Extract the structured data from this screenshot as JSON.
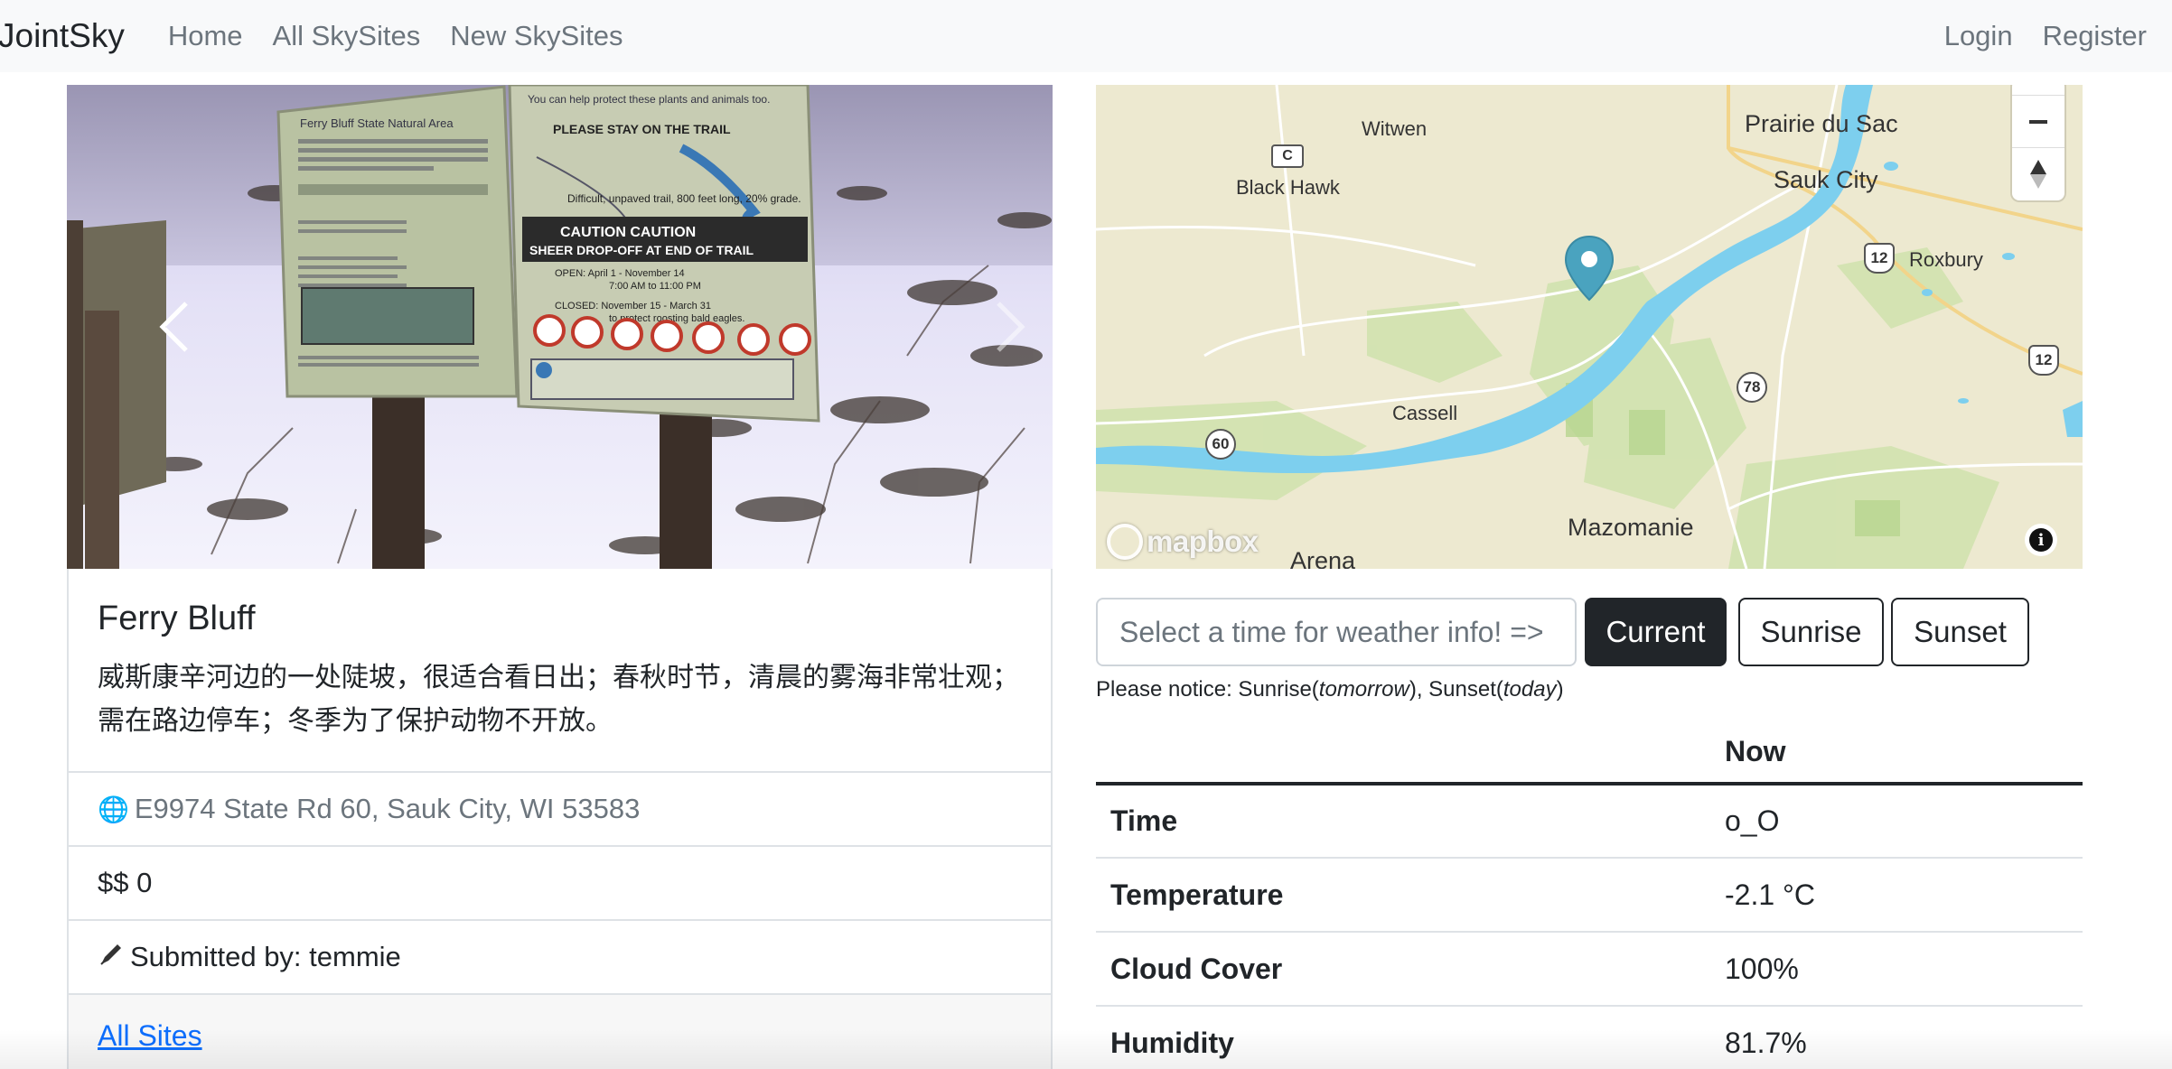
{
  "navbar": {
    "brand": "JointSky",
    "links": [
      "Home",
      "All SkySites",
      "New SkySites"
    ],
    "right_links": [
      "Login",
      "Register"
    ]
  },
  "carousel": {
    "sign_title": "Ferry Bluff State Natural Area",
    "sign_header": "You can help protect these plants and animals too.",
    "sign_stay": "PLEASE STAY ON THE TRAIL",
    "sign_trail": "Difficult, unpaved trail, 800 feet long, 20% grade.",
    "sign_caution": "CAUTION     CAUTION",
    "sign_dropoff": "SHEER DROP-OFF AT END OF TRAIL",
    "sign_open": "OPEN:     April 1 - November 14",
    "sign_open_hours": "7:00 AM to 11:00 PM",
    "sign_closed": "CLOSED:  November 15 - March 31",
    "sign_closed_reason": "to protect roosting bald eagles.",
    "prev_icon": "chevron-left-icon",
    "next_icon": "chevron-right-icon"
  },
  "site": {
    "title": "Ferry Bluff",
    "description": "威斯康辛河边的一处陡坡，很适合看日出；春秋时节，清晨的雾海非常壮观；需在路边停车；冬季为了保护动物不开放。",
    "address_icon": "globe-icon",
    "address": "E9974 State Rd 60, Sauk City, WI 53583",
    "price": "$$ 0",
    "submitted_icon": "pen-icon",
    "submitted_by": "Submitted by: temmie",
    "all_sites_link": "All Sites"
  },
  "map": {
    "labels": {
      "witwen": "Witwen",
      "black_hawk": "Black Hawk",
      "prairie_du_sac": "Prairie du Sac",
      "sauk_city": "Sauk City",
      "roxbury": "Roxbury",
      "cassell": "Cassell",
      "mazomanie": "Mazomanie",
      "arena": "Arena"
    },
    "shields": {
      "c": "C",
      "hwy12a": "12",
      "hwy12b": "12",
      "hwy78": "78",
      "hwy60": "60"
    },
    "logo": "mapbox",
    "info_icon": "info-icon",
    "zoom_out_icon": "minus-icon",
    "compass_icon": "compass-icon",
    "colors": {
      "water": "#7dcfee",
      "land": "#ede9d0",
      "park": "#cfe2ad",
      "marker": "#4aa3bf"
    }
  },
  "weather": {
    "input_placeholder": "Select a time for weather info! =>",
    "buttons": {
      "current": "Current",
      "sunrise": "Sunrise",
      "sunset": "Sunset"
    },
    "notice": {
      "prefix": "Please notice: Sunrise(",
      "tomorrow": "tomorrow",
      "middle": "), Sunset(",
      "today": "today",
      "suffix": ")"
    },
    "table": {
      "header": [
        "",
        "Now"
      ],
      "rows": [
        {
          "key": "Time",
          "value": "o_O"
        },
        {
          "key": "Temperature",
          "value": "-2.1 °C"
        },
        {
          "key": "Cloud Cover",
          "value": "100%"
        },
        {
          "key": "Humidity",
          "value": "81.7%"
        }
      ]
    }
  }
}
